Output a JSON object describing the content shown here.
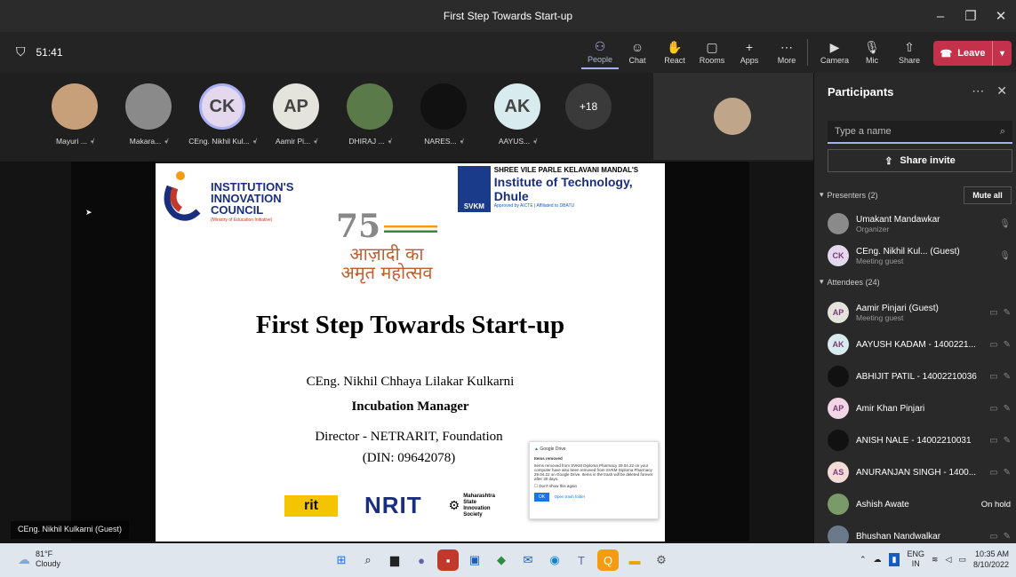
{
  "window": {
    "title": "First Step Towards Start-up",
    "minimize": "–",
    "maximize": "❐",
    "close": "✕"
  },
  "toolbar": {
    "timer": "51:41",
    "tools": [
      {
        "label": "People",
        "icon": "people-icon",
        "glyph": "⚇"
      },
      {
        "label": "Chat",
        "icon": "chat-icon",
        "glyph": "☺"
      },
      {
        "label": "React",
        "icon": "react-icon",
        "glyph": "✋"
      },
      {
        "label": "Rooms",
        "icon": "rooms-icon",
        "glyph": "▢"
      },
      {
        "label": "Apps",
        "icon": "apps-icon",
        "glyph": "+"
      },
      {
        "label": "More",
        "icon": "more-icon",
        "glyph": "⋯"
      }
    ],
    "camera": "Camera",
    "mic": "Mic",
    "share": "Share",
    "leave": "Leave"
  },
  "strip": {
    "participants": [
      {
        "name": "Mayuri ...",
        "initials": "",
        "color": "#c7a07a"
      },
      {
        "name": "Makara...",
        "initials": "",
        "color": "#8a8a8a"
      },
      {
        "name": "CEng. Nikhil Kul...",
        "initials": "CK",
        "color": "#e4d8ee"
      },
      {
        "name": "Aamir Pi...",
        "initials": "AP",
        "color": "#e4e4dc"
      },
      {
        "name": "DHIRAJ ...",
        "initials": "",
        "color": "#5a7a4a"
      },
      {
        "name": "NARES...",
        "initials": "",
        "color": "#111111"
      },
      {
        "name": "AAYUS...",
        "initials": "AK",
        "color": "#d8ecf0"
      }
    ],
    "overflow": "+18"
  },
  "slide": {
    "iic_line1": "INSTITUTION'S",
    "iic_line2": "INNOVATION",
    "iic_line3": "COUNCIL",
    "iic_sub": "(Ministry of Education Initiative)",
    "svkm_box": "SVKM",
    "svkm_line1": "SHREE VILE PARLE KELAVANI MANDAL'S",
    "svkm_line2": "Institute of Technology, Dhule",
    "svkm_line3": "Approved by AICTE | Affiliated to DBATU",
    "azadi_num": "75",
    "azadi_l1": "आज़ादी का",
    "azadi_l2": "अमृत महोत्सव",
    "title": "First Step Towards Start-up",
    "speaker": "CEng. Nikhil Chhaya Lilakar Kulkarni",
    "role": "Incubation Manager",
    "director": "Director - NETRARIT, Foundation",
    "din": "(DIN: 09642078)",
    "logo_rit": "rit",
    "logo_nrit": "NRIT",
    "logo_msis": "Maharashtra State Innovation Society"
  },
  "popup": {
    "app": "Google Drive",
    "heading": "Items removed",
    "body": "Items removed from SVKM Diploma Pharmacy 29.04.22 on your computer have also been removed from SVKM Diploma Pharmacy 29.04.22 on Google Drive. Items in the trash will be deleted forever after 30 days.",
    "checkbox": "Don't show this again",
    "ok": "OK",
    "open": "Open trash folder"
  },
  "caption": "CEng. Nikhil Kulkarni (Guest)",
  "panel": {
    "title": "Participants",
    "search_placeholder": "Type a name",
    "share_invite": "Share invite",
    "presenters": "Presenters (2)",
    "mute_all": "Mute all",
    "attendees": "Attendees (24)",
    "presenter_list": [
      {
        "name": "Umakant Mandawkar",
        "role": "Organizer",
        "initials": "",
        "color": "#8a8a8a"
      },
      {
        "name": "CEng. Nikhil Kul... (Guest)",
        "role": "Meeting guest",
        "initials": "CK",
        "color": "#e4d8ee"
      }
    ],
    "attendee_list": [
      {
        "name": "Aamir Pinjari (Guest)",
        "role": "Meeting guest",
        "initials": "AP",
        "color": "#e4e4dc",
        "status": ""
      },
      {
        "name": "AAYUSH KADAM - 1400221...",
        "role": "",
        "initials": "AK",
        "color": "#d8ecf0",
        "status": ""
      },
      {
        "name": "ABHIJIT PATIL - 14002210036",
        "role": "",
        "initials": "",
        "color": "#111111",
        "status": ""
      },
      {
        "name": "Amir Khan Pinjari",
        "role": "",
        "initials": "AP",
        "color": "#f3d6e6",
        "status": ""
      },
      {
        "name": "ANISH NALE - 14002210031",
        "role": "",
        "initials": "",
        "color": "#111111",
        "status": ""
      },
      {
        "name": "ANURANJAN SINGH - 1400...",
        "role": "",
        "initials": "AS",
        "color": "#f3dcd6",
        "status": ""
      },
      {
        "name": "Ashish Awate",
        "role": "",
        "initials": "",
        "color": "#7a9a6a",
        "status": "On hold"
      },
      {
        "name": "Bhushan Nandwalkar",
        "role": "",
        "initials": "",
        "color": "#6a7a8a",
        "status": ""
      }
    ]
  },
  "taskbar": {
    "temp": "81°F",
    "weather": "Cloudy",
    "lang1": "ENG",
    "lang2": "IN",
    "time": "10:35 AM",
    "date": "8/10/2022"
  }
}
